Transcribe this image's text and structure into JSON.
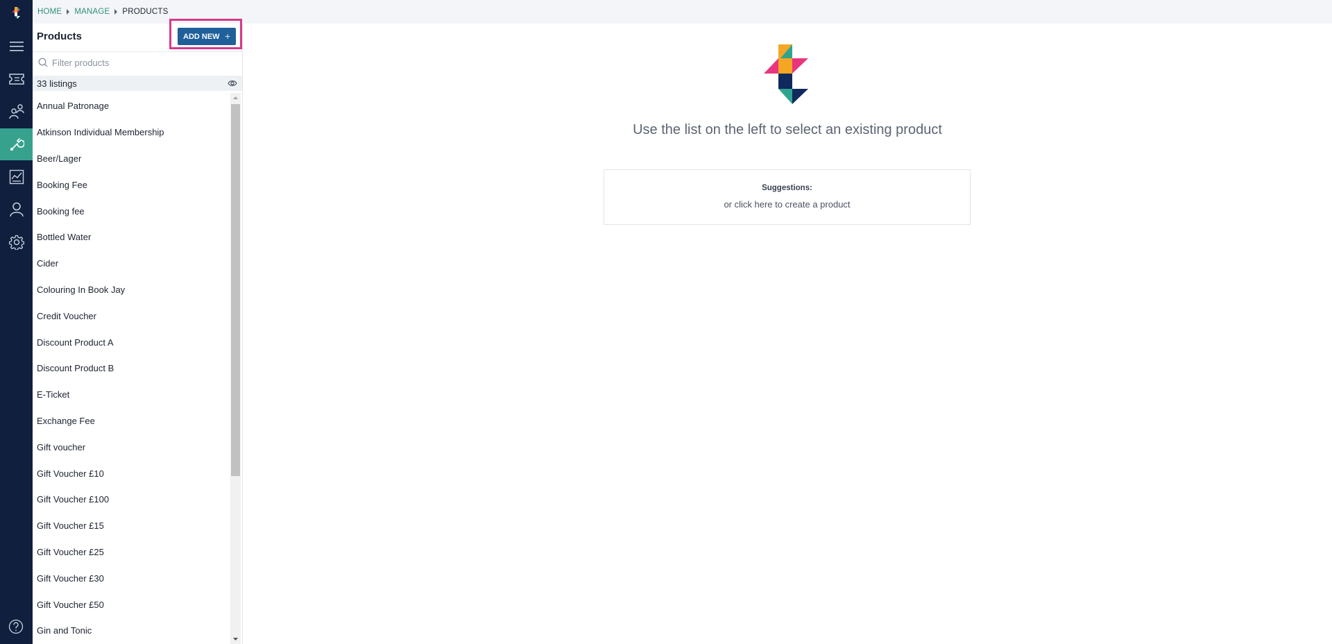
{
  "breadcrumb": {
    "items": [
      "HOME",
      "MANAGE",
      "PRODUCTS"
    ]
  },
  "panel": {
    "title": "Products",
    "add_button_label": "ADD NEW",
    "add_button_icon": "+",
    "filter_placeholder": "Filter products",
    "filter_value": "",
    "count_label": "33 listings",
    "items": [
      "Annual Patronage",
      "Atkinson Individual Membership",
      "Beer/Lager",
      "Booking Fee",
      "Booking fee",
      "Bottled Water",
      "Cider",
      "Colouring In Book Jay",
      "Credit Voucher",
      "Discount Product A",
      "Discount Product B",
      "E-Ticket",
      "Exchange Fee",
      "Gift voucher",
      "Gift Voucher £10",
      "Gift Voucher £100",
      "Gift Voucher £15",
      "Gift Voucher £25",
      "Gift Voucher £30",
      "Gift Voucher £50",
      "Gin and Tonic"
    ]
  },
  "main": {
    "empty_message": "Use the list on the left to select an existing product",
    "suggestions_label": "Suggestions:",
    "suggestion_link": "or click here to create a product"
  },
  "nav": {
    "items": [
      "menu-icon",
      "ticket-icon",
      "audience-icon",
      "wrench-icon",
      "reports-icon",
      "person-icon",
      "gear-icon"
    ],
    "active": "wrench-icon",
    "help_icon": "help-icon"
  },
  "colors": {
    "rail": "#0f1f3d",
    "active_nav": "#36a28e",
    "add_button": "#1f5f9a",
    "highlight": "#d63a8a",
    "breadcrumb_link": "#2f8f7e"
  }
}
